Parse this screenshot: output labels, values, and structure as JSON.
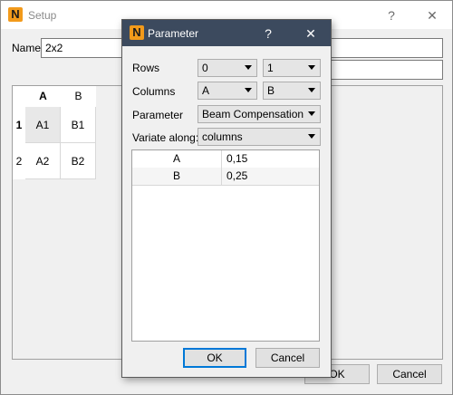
{
  "setup": {
    "title": "Setup",
    "help_glyph": "?",
    "close_glyph": "✕",
    "name_label": "Name",
    "name_value": "2x2",
    "second_field_value": "",
    "grid": {
      "col_headers": [
        "A",
        "B"
      ],
      "rows": [
        {
          "header": "1",
          "cells": [
            "A1",
            "B1"
          ]
        },
        {
          "header": "2",
          "cells": [
            "A2",
            "B2"
          ]
        }
      ]
    },
    "ok_label": "OK",
    "cancel_label": "Cancel"
  },
  "param": {
    "title": "Parameter",
    "help_glyph": "?",
    "close_glyph": "✕",
    "rows_label": "Rows",
    "rows_from": "0",
    "rows_to": "1",
    "columns_label": "Columns",
    "columns_from": "A",
    "columns_to": "B",
    "parameter_label": "Parameter",
    "parameter_value": "Beam Compensation",
    "variate_label": "Variate along:",
    "variate_value": "columns",
    "table": [
      {
        "key": "A",
        "value": "0,15"
      },
      {
        "key": "B",
        "value": "0,25"
      }
    ],
    "ok_label": "OK",
    "cancel_label": "Cancel"
  },
  "app_icon_letter": "N",
  "colors": {
    "app_icon": "#f29a1b",
    "dialog_titlebar": "#3c4a5e",
    "focus_border": "#0078d7"
  }
}
